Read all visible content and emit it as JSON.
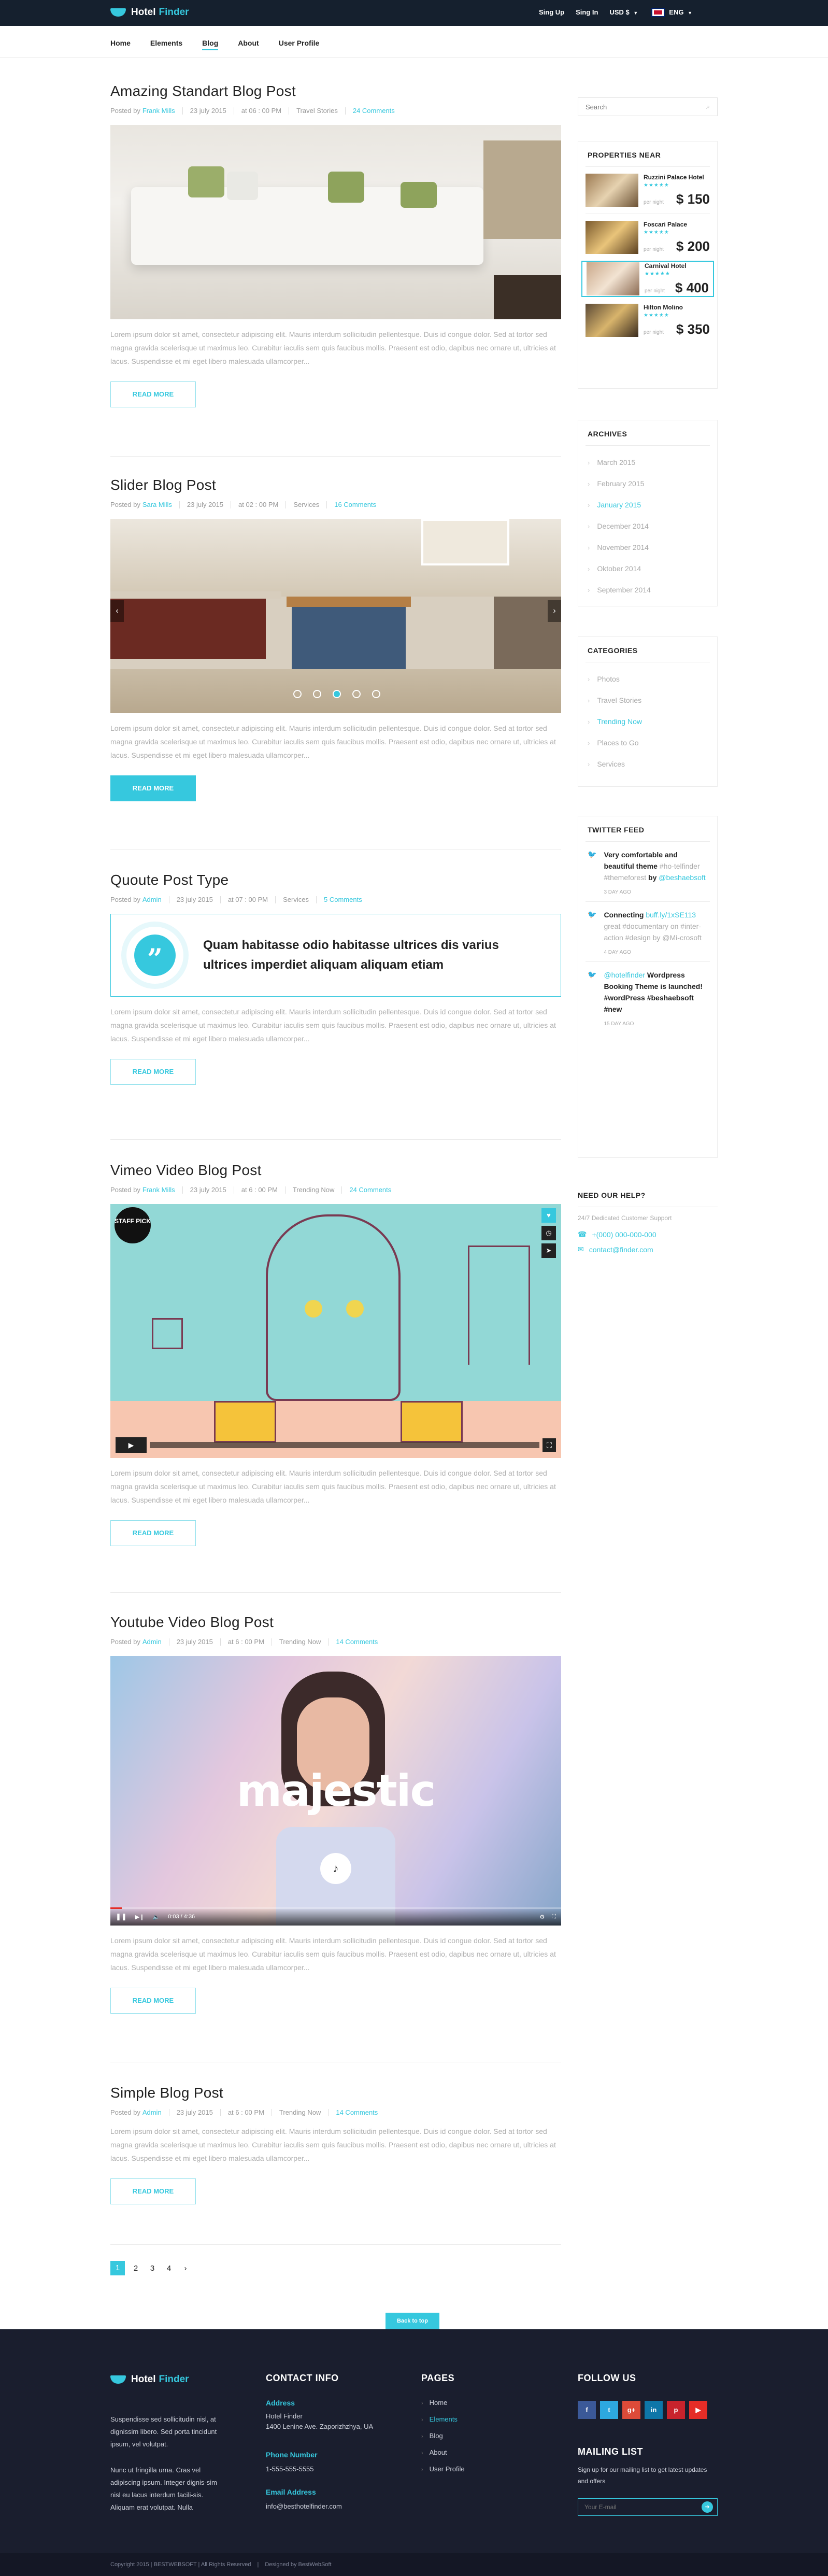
{
  "brand": {
    "name": "Hotel",
    "name_accent": "Finder"
  },
  "topbar": {
    "signup": "Sing Up",
    "signin": "Sing In",
    "currency": "USD $",
    "language": "ENG"
  },
  "nav": {
    "items": [
      "Home",
      "Elements",
      "Blog",
      "About",
      "User Profile"
    ],
    "active": "Blog"
  },
  "colors": {
    "accent": "#36c8de",
    "dark": "#15202e",
    "footer": "#1a1e2e"
  },
  "excerpt": "Lorem ipsum dolor sit amet, consectetur adipiscing elit. Mauris interdum sollicitudin pellentesque. Duis id congue dolor. Sed at tortor sed magna gravida scelerisque ut maximus leo. Curabitur iaculis sem quis faucibus mollis. Praesent est odio, dapibus nec ornare ut, ultricies at lacus. Suspendisse et mi eget libero malesuada ullamcorper...",
  "read_more": "READ MORE",
  "posts": [
    {
      "title": "Amazing Standart Blog Post",
      "author": "Frank Mills",
      "date": "23 july 2015",
      "time": "at 06 : 00 PM",
      "category": "Travel Stories",
      "comments": "24 Comments"
    },
    {
      "title": "Slider  Blog Post",
      "author": "Sara Mills",
      "date": "23 july 2015",
      "time": "at 02 : 00 PM",
      "category": "Services",
      "comments": "16 Comments"
    },
    {
      "title": "Quoute Post Type",
      "author": "Admin",
      "date": "23 july 2015",
      "time": "at 07 : 00 PM",
      "category": "Services",
      "comments": "5 Comments",
      "quote": "Quam habitasse odio habitasse ultrices dis varius ultrices imperdiet aliquam aliquam etiam"
    },
    {
      "title": "Vimeo Video Blog Post",
      "author": "Frank Mills",
      "date": "23 july 2015",
      "time": "at 6 : 00 PM",
      "category": "Trending Now",
      "comments": "24 Comments",
      "badge": "STAFF PICK"
    },
    {
      "title": "Youtube Video Blog Post",
      "author": "Admin",
      "date": "23 july 2015",
      "time": "at 6 : 00 PM",
      "category": "Trending Now",
      "comments": "14 Comments",
      "overlay": "majestic",
      "player_time": "0:03 / 4:36"
    },
    {
      "title": "Simple Blog Post",
      "author": "Admin",
      "date": "23 july 2015",
      "time": "at 6 : 00 PM",
      "category": "Trending Now",
      "comments": "14 Comments"
    }
  ],
  "posted_by": "Posted by",
  "pagination": {
    "pages": [
      "1",
      "2",
      "3",
      "4"
    ],
    "current": "1",
    "next": "›"
  },
  "back_to_top": "Back to top",
  "sidebar": {
    "search_placeholder": "Search",
    "properties": {
      "title": "PROPERTIES NEAR",
      "per_night": "per night",
      "items": [
        {
          "name": "Ruzzini Palace Hotel",
          "stars": "★★★★★",
          "price": "$ 150"
        },
        {
          "name": "Foscari Palace",
          "stars": "★★★★★",
          "price": "$ 200"
        },
        {
          "name": "Carnival Hotel",
          "stars": "★★★★★",
          "price": "$ 400"
        },
        {
          "name": "Hilton Molino",
          "stars": "★★★★★",
          "price": "$ 350"
        }
      ]
    },
    "archives": {
      "title": "ARCHIVES",
      "items": [
        "March 2015",
        "February 2015",
        "January 2015",
        "December 2014",
        "November 2014",
        "Oktober 2014",
        "September 2014"
      ],
      "active": "January 2015"
    },
    "categories": {
      "title": "CATEGORIES",
      "items": [
        "Photos",
        "Travel Stories",
        "Trending Now",
        "Places to Go",
        "Services"
      ],
      "active": "Trending Now"
    },
    "twitter": {
      "title": "TWITTER FEED",
      "tweets": [
        {
          "p1": "Very comfortable and beautiful theme",
          "p2": " #ho-telfinder #themeforest",
          "p3": " by ",
          "p4": "@beshaebsoft",
          "ago": "3 DAY AGO"
        },
        {
          "p1": "Connecting ",
          "p2": "buff.ly/1xSE113",
          "p3": " great #documentary on #inter-action #design by @Mi-crosoft",
          "p4": "",
          "ago": "4 DAY AGO"
        },
        {
          "p1": "",
          "p2": "@hotelfinder",
          "p3": " Wordpress Booking Theme is launched! #wordPress #beshaebsoft #new",
          "p4": "",
          "ago": "15 DAY AGO"
        }
      ]
    },
    "help": {
      "title": "NEED OUR HELP?",
      "subtitle": "24/7 Dedicated Customer Support",
      "phone": "+(000) 000-000-000",
      "email": "contact@finder.com"
    }
  },
  "footer": {
    "about1": "Suspendisse sed sollicitudin nisl, at dignissim libero. Sed porta tincidunt ipsum, vel volutpat.",
    "about2": "Nunc ut fringilla urna. Cras vel adipiscing ipsum. Integer dignis-sim nisl eu lacus interdum facili-sis. Aliquam erat volutpat. Nulla",
    "contact_title": "CONTACT INFO",
    "address_label": "Address",
    "address_line1": "Hotel Finder",
    "address_line2": "1400 Lenine Ave. Zaporizhzhya, UA",
    "phone_label": "Phone Number",
    "phone": "1-555-555-5555",
    "email_label": "Email Address",
    "email": "info@besthotelfinder.com",
    "pages_title": "PAGES",
    "pages": [
      "Home",
      "Elements",
      "Blog",
      "About",
      "User Profile"
    ],
    "pages_active": "Elements",
    "follow_title": "FOLLOW US",
    "social": [
      "f",
      "t",
      "g+",
      "in",
      "p",
      "▶"
    ],
    "mailing_title": "MAILING LIST",
    "mailing_text": "Sign up for our mailing list to get latest updates and offers",
    "email_placeholder": "Your E-mail",
    "copyright": "Copyright   2015  |  BESTWEBSOFT  |  All Rights Reserved",
    "designed": "Designed by BestWebSoft"
  }
}
